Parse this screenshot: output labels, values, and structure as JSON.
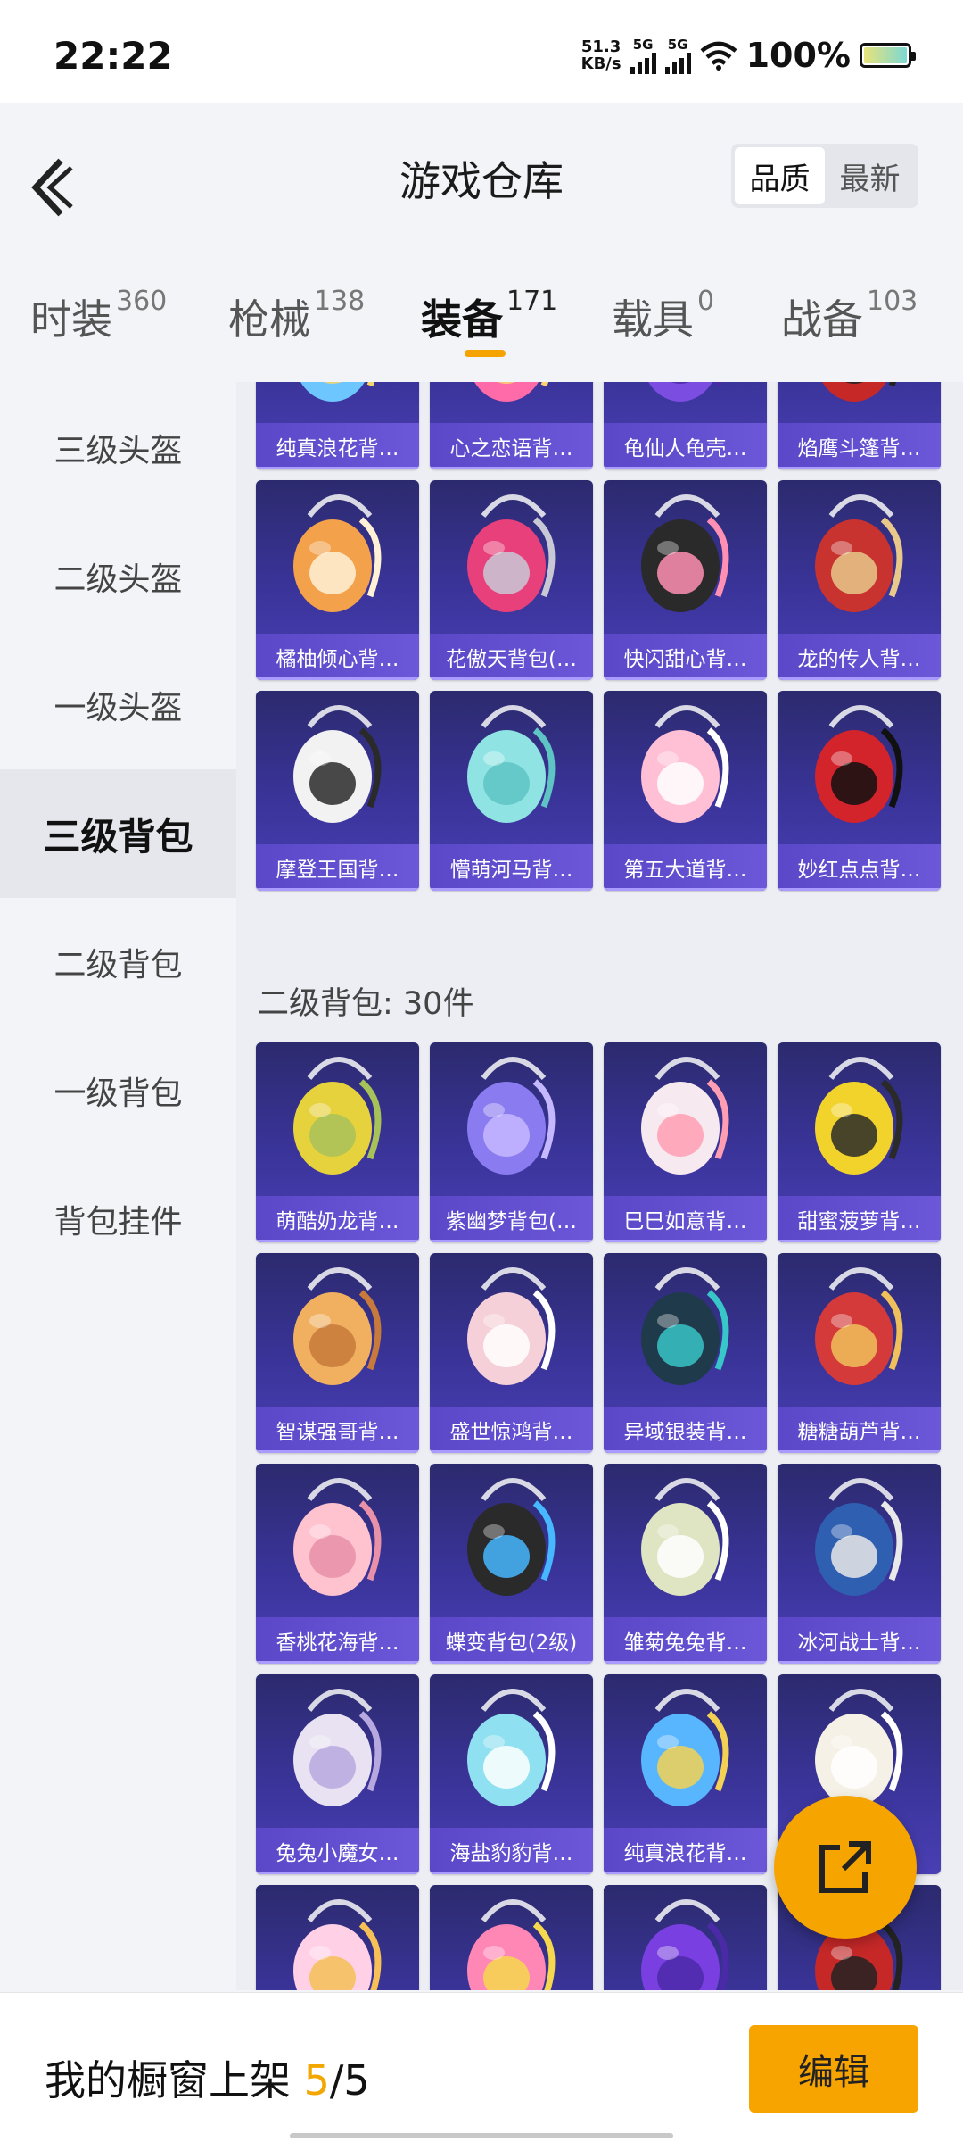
{
  "status": {
    "time": "22:22",
    "speed_value": "51.3",
    "speed_unit": "KB/s",
    "sim1": "5G",
    "sim2": "5G",
    "battery": "100%"
  },
  "header": {
    "title": "游戏仓库",
    "sort_quality": "品质",
    "sort_newest": "最新"
  },
  "tabs": [
    {
      "label": "时装",
      "count": "360"
    },
    {
      "label": "枪械",
      "count": "138"
    },
    {
      "label": "装备",
      "count": "171"
    },
    {
      "label": "载具",
      "count": "0"
    },
    {
      "label": "战备",
      "count": "103"
    }
  ],
  "sidebar": {
    "items": [
      {
        "label": "三级头盔"
      },
      {
        "label": "二级头盔"
      },
      {
        "label": "一级头盔"
      },
      {
        "label": "三级背包"
      },
      {
        "label": "二级背包"
      },
      {
        "label": "一级背包"
      },
      {
        "label": "背包挂件"
      }
    ]
  },
  "sections": [
    {
      "title": "",
      "items": [
        "纯真浪花背…",
        "心之恋语背…",
        "龟仙人龟壳…",
        "焰鹰斗篷背…",
        "橘柚倾心背…",
        "花傲天背包(…",
        "快闪甜心背…",
        "龙的传人背…",
        "摩登王国背…",
        "懵萌河马背…",
        "第五大道背…",
        "妙红点点背…"
      ]
    },
    {
      "title": "二级背包: 30件",
      "items": [
        "萌酷奶龙背…",
        "紫幽梦背包(…",
        "巳巳如意背…",
        "甜蜜菠萝背…",
        "智谋强哥背…",
        "盛世惊鸿背…",
        "异域银装背…",
        "糖糖葫芦背…",
        "香桃花海背…",
        "蝶变背包(2级)",
        "雏菊兔兔背…",
        "冰河战士背…",
        "兔兔小魔女…",
        "海盐豹豹背…",
        "纯真浪花背…",
        "",
        "",
        "",
        "",
        ""
      ]
    }
  ],
  "bottom": {
    "showcase_label": "我的橱窗上架",
    "showcase_current": "5",
    "showcase_total": "/5",
    "edit_label": "编辑"
  },
  "colors": {
    "accent": "#f6a400",
    "card_bg": "#3a349a",
    "card_label": "#6352d2"
  }
}
